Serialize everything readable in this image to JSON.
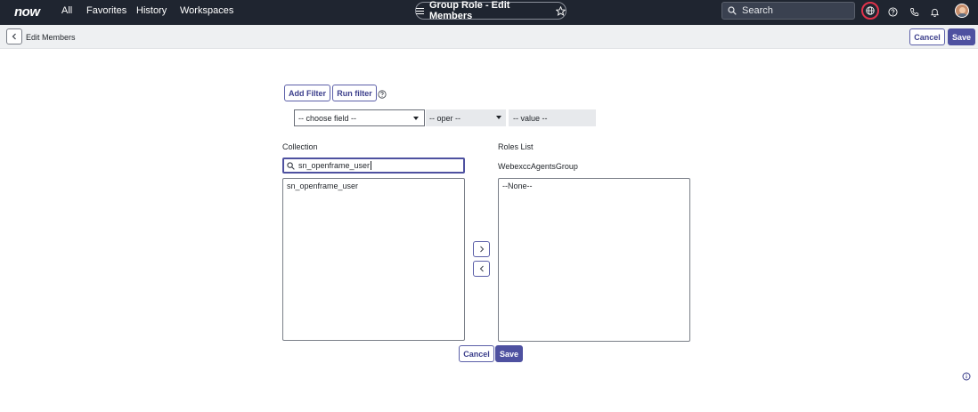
{
  "topnav": {
    "logo": "now",
    "links": [
      "All",
      "Favorites",
      "History",
      "Workspaces"
    ],
    "page_title": "Group Role - Edit Members",
    "search_placeholder": "Search"
  },
  "header": {
    "title": "Edit Members",
    "cancel_label": "Cancel",
    "save_label": "Save"
  },
  "filter": {
    "add_filter_label": "Add Filter",
    "run_filter_label": "Run filter",
    "field_select": "-- choose field --",
    "oper_select": "-- oper --",
    "value_placeholder": "-- value --"
  },
  "collection": {
    "label": "Collection",
    "search_value": "sn_openframe_user",
    "items": [
      "sn_openframe_user"
    ]
  },
  "roles": {
    "label": "Roles List",
    "group_name": "WebexccAgentsGroup",
    "items": [
      "--None--"
    ]
  },
  "footer": {
    "cancel_label": "Cancel",
    "save_label": "Save"
  },
  "colors": {
    "topbar": "#1f2530",
    "accent": "#4e51a0",
    "globe_highlight": "#e0334b"
  }
}
